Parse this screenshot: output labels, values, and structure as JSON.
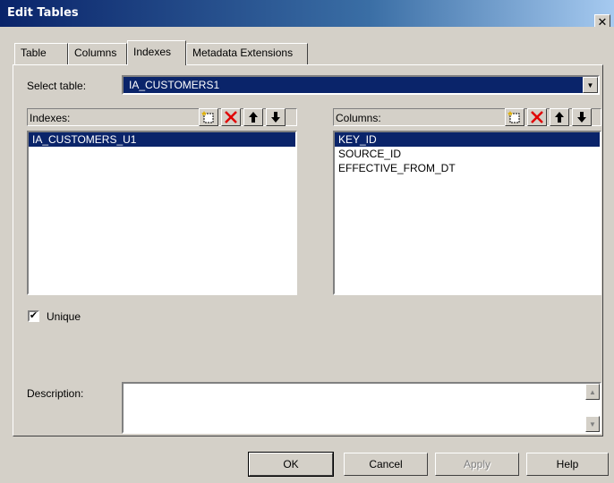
{
  "window": {
    "title": "Edit Tables",
    "close_glyph": "✕"
  },
  "tabs": [
    {
      "label": "Table"
    },
    {
      "label": "Columns"
    },
    {
      "label": "Indexes"
    },
    {
      "label": "Metadata Extensions"
    }
  ],
  "active_tab": "Indexes",
  "select_table": {
    "label": "Select table:",
    "value": "IA_CUSTOMERS1"
  },
  "indexes": {
    "label": "Indexes:",
    "items": [
      "IA_CUSTOMERS_U1"
    ],
    "selected_index": 0
  },
  "columns": {
    "label": "Columns:",
    "items": [
      "KEY_ID",
      "SOURCE_ID",
      "EFFECTIVE_FROM_DT"
    ],
    "selected_index": 0
  },
  "toolbar": {
    "icons": [
      "new-icon",
      "delete-icon",
      "move-up-icon",
      "move-down-icon"
    ],
    "colors": {
      "delete": "#e00000",
      "arrow": "#000000",
      "new_star": "#e0b000"
    }
  },
  "unique": {
    "label": "Unique",
    "checked": true
  },
  "description": {
    "label": "Description:",
    "value": ""
  },
  "buttons": {
    "ok": "OK",
    "cancel": "Cancel",
    "apply": "Apply",
    "help": "Help"
  },
  "colors": {
    "face": "#d4d0c8",
    "selection": "#0a246a",
    "title_start": "#0a246a",
    "title_end": "#a6caf0"
  }
}
